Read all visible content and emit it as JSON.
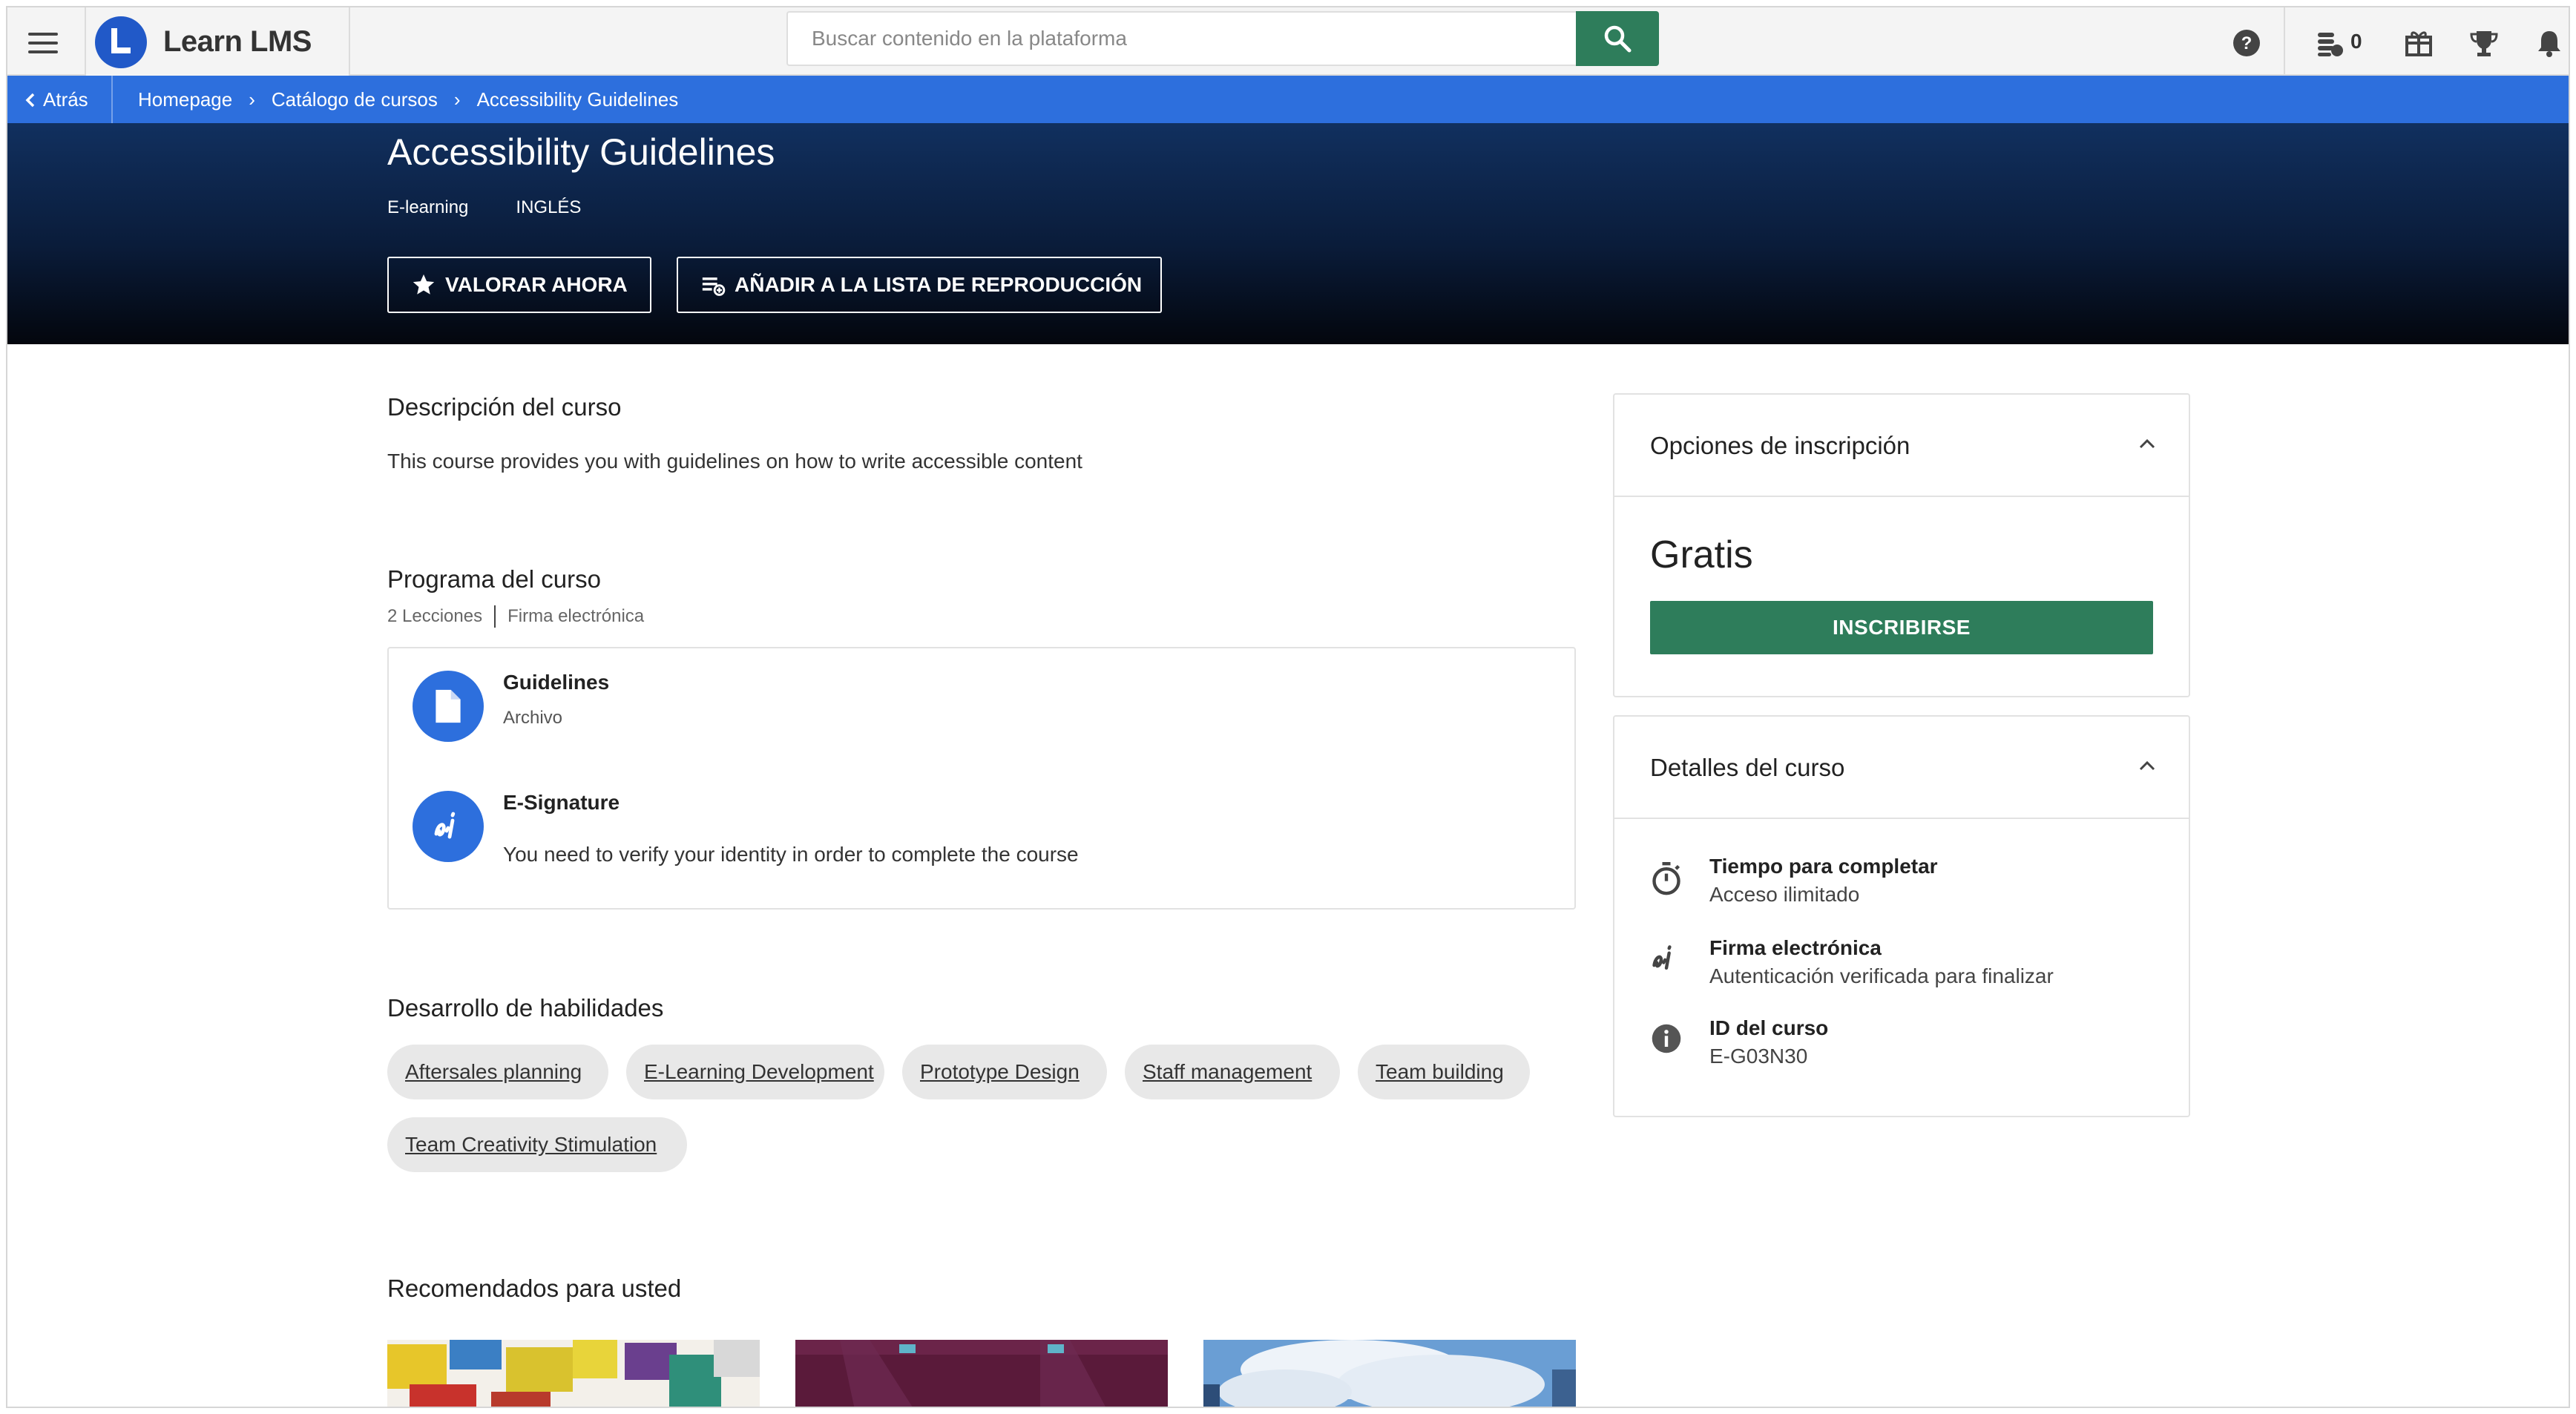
{
  "app": {
    "name": "Learn LMS"
  },
  "search": {
    "placeholder": "Buscar contenido en la plataforma"
  },
  "topbar": {
    "coins": "0"
  },
  "breadcrumb": {
    "back_label": "Atrás",
    "items": [
      "Homepage",
      "Catálogo de cursos",
      "Accessibility Guidelines"
    ]
  },
  "course": {
    "title": "Accessibility Guidelines",
    "type": "E-learning",
    "language": "INGLÉS",
    "rate_label": "VALORAR AHORA",
    "playlist_label": "AÑADIR A LA LISTA DE REPRODUCCIÓN"
  },
  "description": {
    "heading": "Descripción del curso",
    "text": "This course provides you with guidelines on how to write accessible content"
  },
  "program": {
    "heading": "Programa del curso",
    "lessons_count": "2 Lecciones",
    "signature": "Firma electrónica",
    "lessons": [
      {
        "title": "Guidelines",
        "subtitle": "Archivo",
        "icon": "file-icon"
      },
      {
        "title": "E-Signature",
        "subtitle": "You need to verify your identity in order to complete the course",
        "icon": "signature-icon"
      }
    ]
  },
  "skills": {
    "heading": "Desarrollo de habilidades",
    "tags": [
      "Aftersales planning",
      "E-Learning Development",
      "Prototype Design",
      "Staff management",
      "Team building",
      "Team Creativity Stimulation"
    ]
  },
  "recommended": {
    "heading": "Recomendados para usted"
  },
  "enrollment": {
    "heading": "Opciones de inscripción",
    "price": "Gratis",
    "button": "INSCRIBIRSE"
  },
  "details": {
    "heading": "Detalles del curso",
    "rows": [
      {
        "label": "Tiempo para completar",
        "value": "Acceso ilimitado",
        "icon": "timer-icon"
      },
      {
        "label": "Firma electrónica",
        "value": "Autenticación verificada para finalizar",
        "icon": "signature-icon"
      },
      {
        "label": "ID del curso",
        "value": "E-G03N30",
        "icon": "info-icon"
      }
    ]
  },
  "colors": {
    "primary_blue": "#2d6fdd",
    "accent_green": "#2e7d5b",
    "hero_dark": "#0a1c3a"
  }
}
